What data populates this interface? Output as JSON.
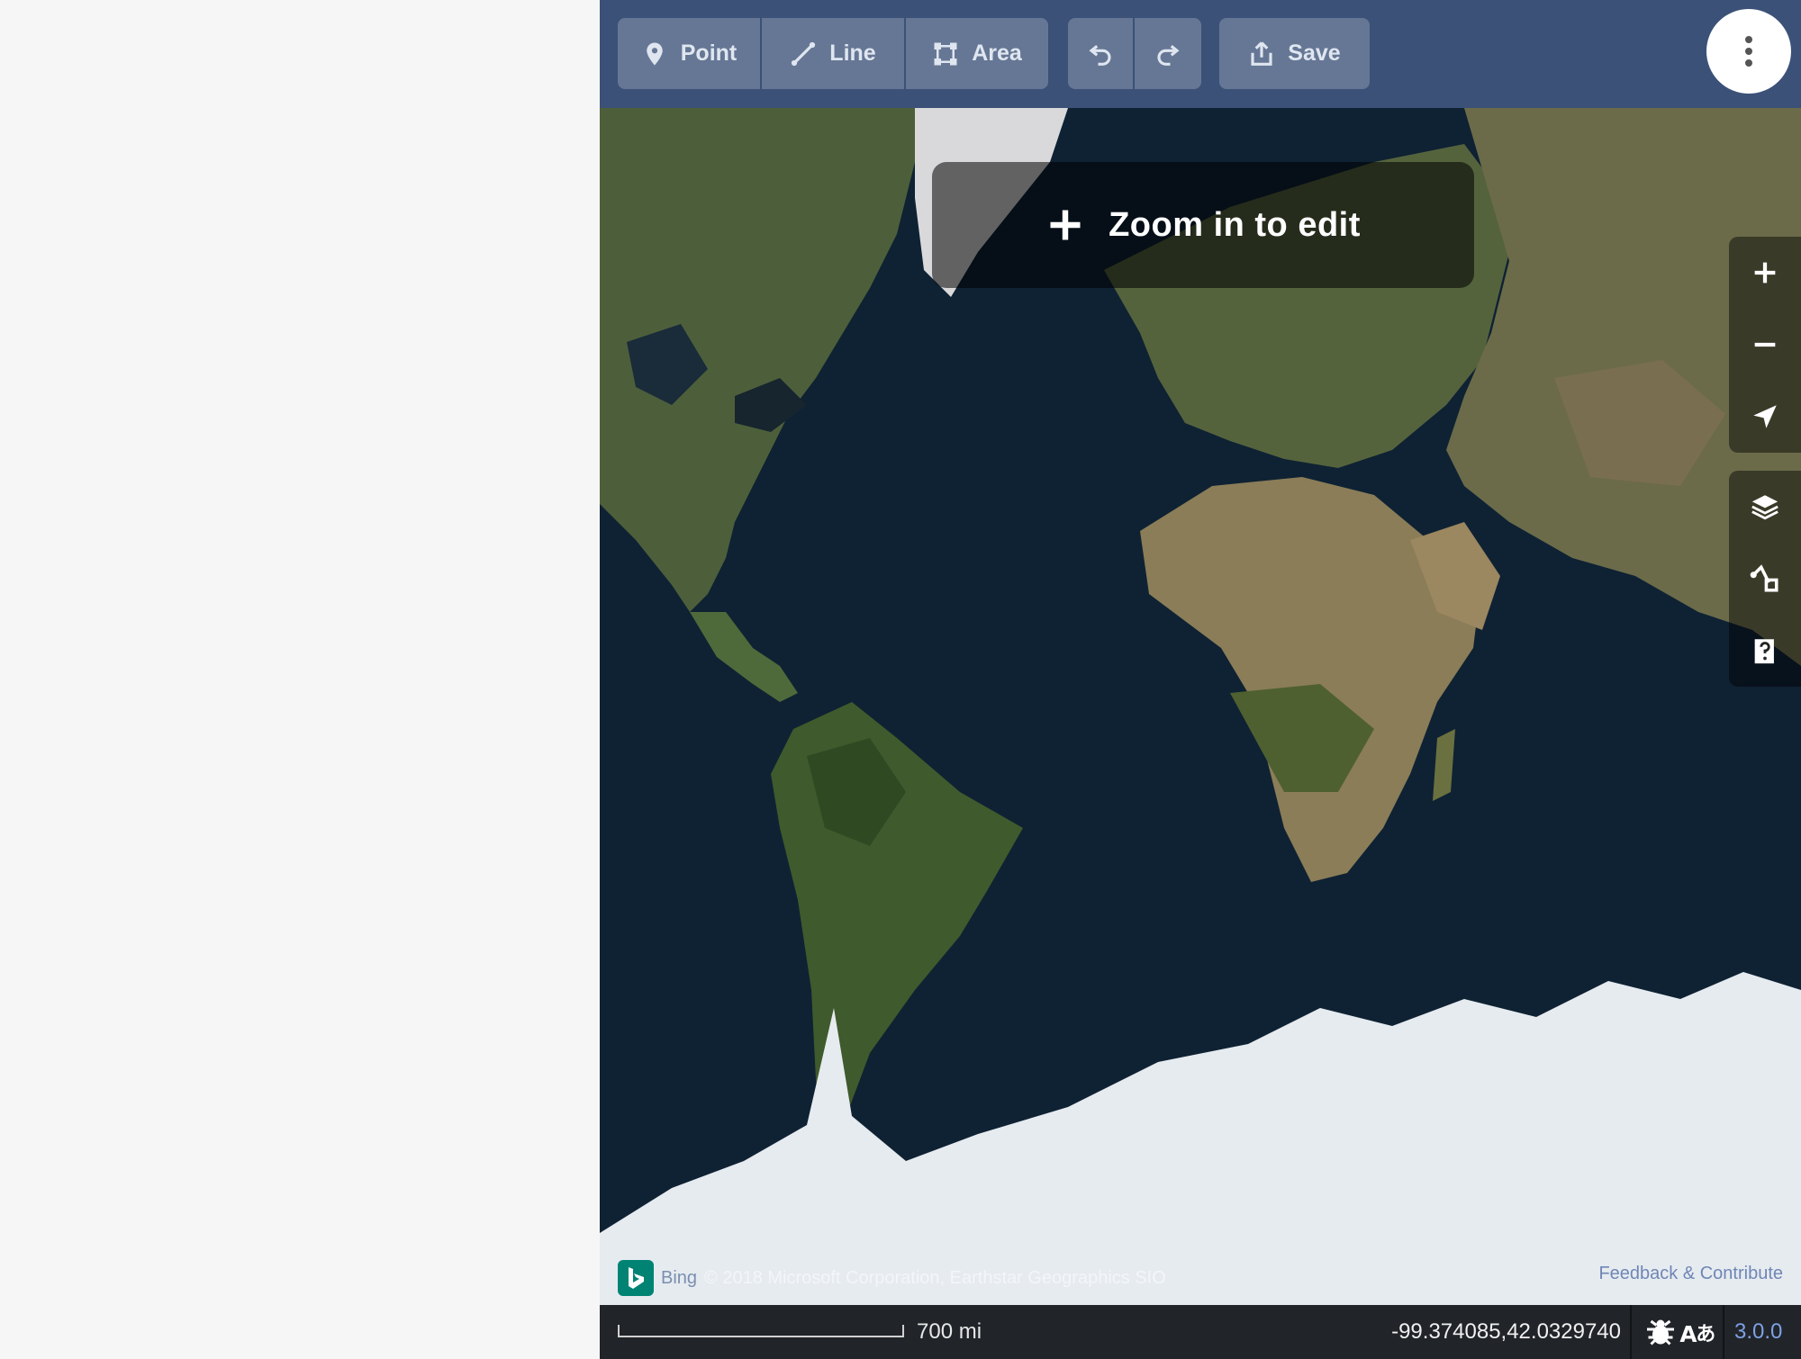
{
  "toolbar": {
    "point_label": "Point",
    "line_label": "Line",
    "area_label": "Area",
    "save_label": "Save"
  },
  "map": {
    "zoom_notice": "Zoom in to edit",
    "imagery": "satellite world map"
  },
  "attribution": {
    "provider": "Bing",
    "text": "© 2018 Microsoft Corporation, Earthstar Geographics SIO",
    "feedback_link": "Feedback & Contribute"
  },
  "footer": {
    "scale_label": "700 mi",
    "coordinates": "-99.374085,42.0329740",
    "version": "3.0.0"
  },
  "icons": {
    "toolbar": [
      "point-icon",
      "line-icon",
      "area-icon",
      "undo-icon",
      "redo-icon",
      "save-icon",
      "more-icon"
    ],
    "map_controls": [
      "zoom-in-icon",
      "zoom-out-icon",
      "geolocate-icon"
    ],
    "panel_controls": [
      "layers-icon",
      "map-data-icon",
      "help-icon"
    ],
    "footer": [
      "bug-icon",
      "language-icon"
    ]
  },
  "colors": {
    "topbar": "#3b5178",
    "bing": "#008373",
    "version_link": "#7ea0e6"
  }
}
